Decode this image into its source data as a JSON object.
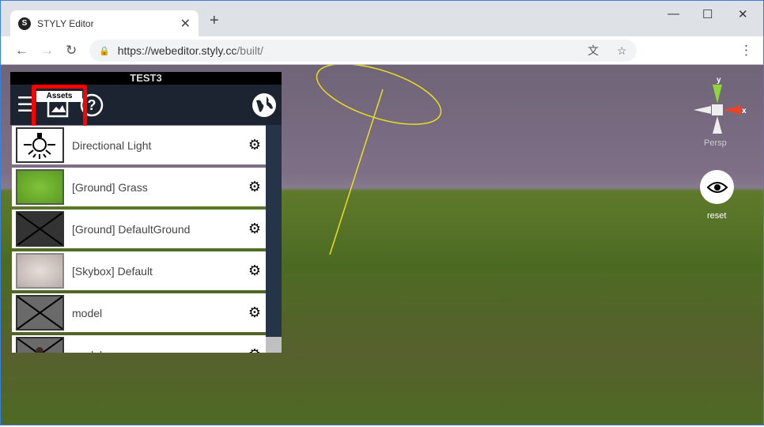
{
  "browser": {
    "tab_title": "STYLY Editor",
    "url_host": "https://webeditor.styly.cc",
    "url_path": "/built/"
  },
  "panel": {
    "title": "TEST3",
    "tooltip": "Assets",
    "items": [
      {
        "label": "Directional Light",
        "thumb": "light-bulb"
      },
      {
        "label": "[Ground] Grass",
        "thumb": "grass"
      },
      {
        "label": "[Ground] DefaultGround",
        "thumb": "dark"
      },
      {
        "label": "[Skybox] Default",
        "thumb": "sky"
      },
      {
        "label": "model",
        "thumb": "gray"
      },
      {
        "label": "model_vrm",
        "thumb": "gray"
      }
    ]
  },
  "gizmo": {
    "y_label": "y",
    "x_label": "x",
    "mode": "Persp"
  },
  "reset_label": "reset",
  "colors": {
    "highlight": "#ff0000",
    "panel_bg": "#1b2430",
    "x_axis": "#e8442a",
    "y_axis": "#8ed43a"
  }
}
